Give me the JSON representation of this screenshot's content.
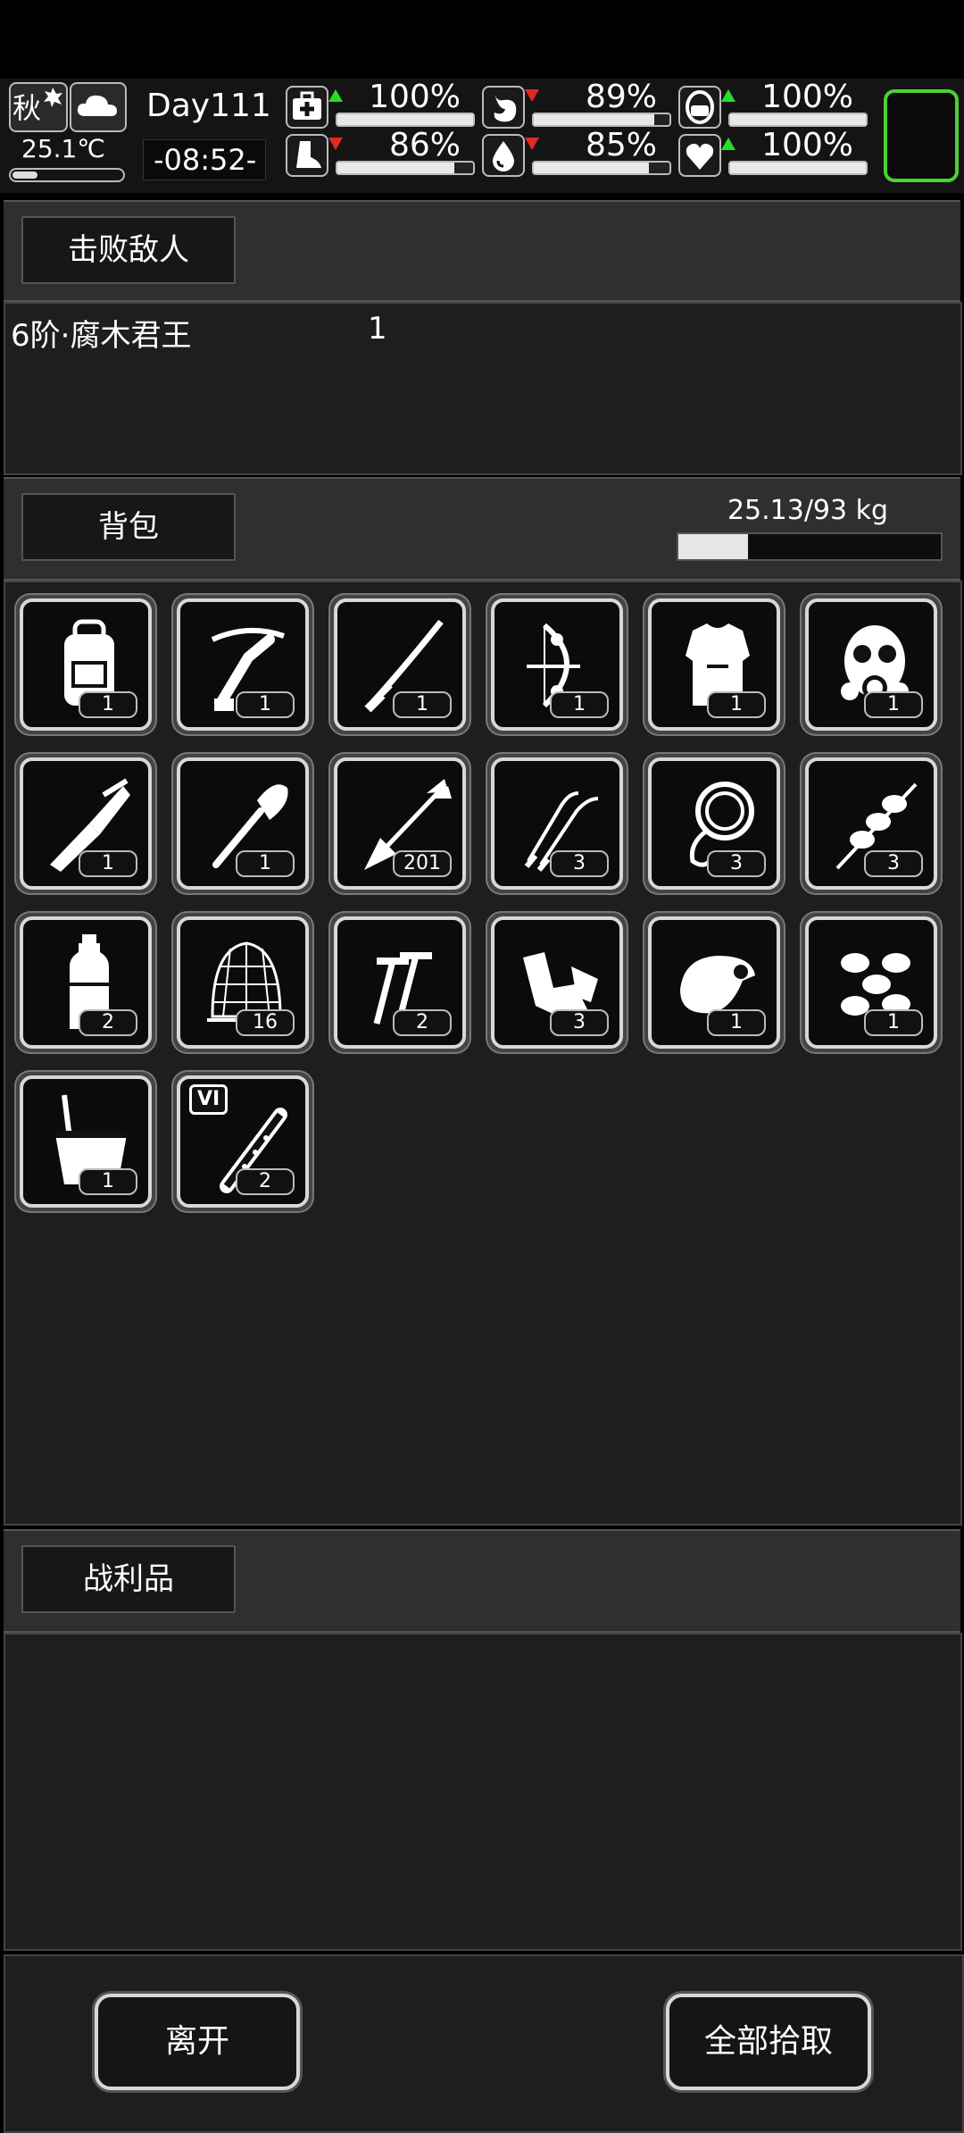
{
  "hud": {
    "season": "秋",
    "temperature": "25.1℃",
    "temperature_level": 0.22,
    "day": "Day111",
    "time": "-08:52-",
    "stats": [
      {
        "name": "health",
        "icon": "medkit-icon",
        "trend": "up",
        "percent": "100%",
        "value": 1.0
      },
      {
        "name": "hunger",
        "icon": "stomach-icon",
        "trend": "down",
        "percent": "89%",
        "value": 0.89
      },
      {
        "name": "mood",
        "icon": "pill-icon",
        "trend": "up",
        "percent": "100%",
        "value": 1.0
      },
      {
        "name": "stamina",
        "icon": "foot-icon",
        "trend": "down",
        "percent": "86%",
        "value": 0.86
      },
      {
        "name": "thirst",
        "icon": "water-drop-icon",
        "trend": "down",
        "percent": "85%",
        "value": 0.85
      },
      {
        "name": "spirit",
        "icon": "heart-icon",
        "trend": "up",
        "percent": "100%",
        "value": 1.0
      }
    ],
    "colors": {
      "up": "#2bdc2b",
      "down": "#e02828",
      "slot_border": "#4ad233"
    }
  },
  "defeated": {
    "tab_label": "击败敌人",
    "enemies": [
      {
        "name": "6阶·腐木君王",
        "count": "1"
      }
    ]
  },
  "backpack": {
    "tab_label": "背包",
    "weight": "25.13/93 kg",
    "weight_ratio": 0.27,
    "items": [
      {
        "icon": "backpack-icon",
        "count": "1"
      },
      {
        "icon": "crossbow-icon",
        "count": "1"
      },
      {
        "icon": "katana-icon",
        "count": "1"
      },
      {
        "icon": "compound-bow-icon",
        "count": "1"
      },
      {
        "icon": "body-armor-icon",
        "count": "1"
      },
      {
        "icon": "gas-mask-icon",
        "count": "1"
      },
      {
        "icon": "multitool-knife-icon",
        "count": "1"
      },
      {
        "icon": "shovel-icon",
        "count": "1"
      },
      {
        "icon": "arrow-icon",
        "count": "201"
      },
      {
        "icon": "tweezers-icon",
        "count": "3"
      },
      {
        "icon": "rope-icon",
        "count": "3"
      },
      {
        "icon": "skewer-icon",
        "count": "3"
      },
      {
        "icon": "water-bottle-icon",
        "count": "2"
      },
      {
        "icon": "net-icon",
        "count": "16"
      },
      {
        "icon": "nails-icon",
        "count": "2"
      },
      {
        "icon": "scrap-icon",
        "count": "3"
      },
      {
        "icon": "meat-icon",
        "count": "1"
      },
      {
        "icon": "eggs-icon",
        "count": "1"
      },
      {
        "icon": "bucket-icon",
        "count": "1"
      },
      {
        "icon": "syringe-vi-icon",
        "count": "2",
        "badge": "VI"
      }
    ]
  },
  "loot": {
    "tab_label": "战利品"
  },
  "actions": {
    "leave": "离开",
    "take_all": "全部拾取"
  }
}
